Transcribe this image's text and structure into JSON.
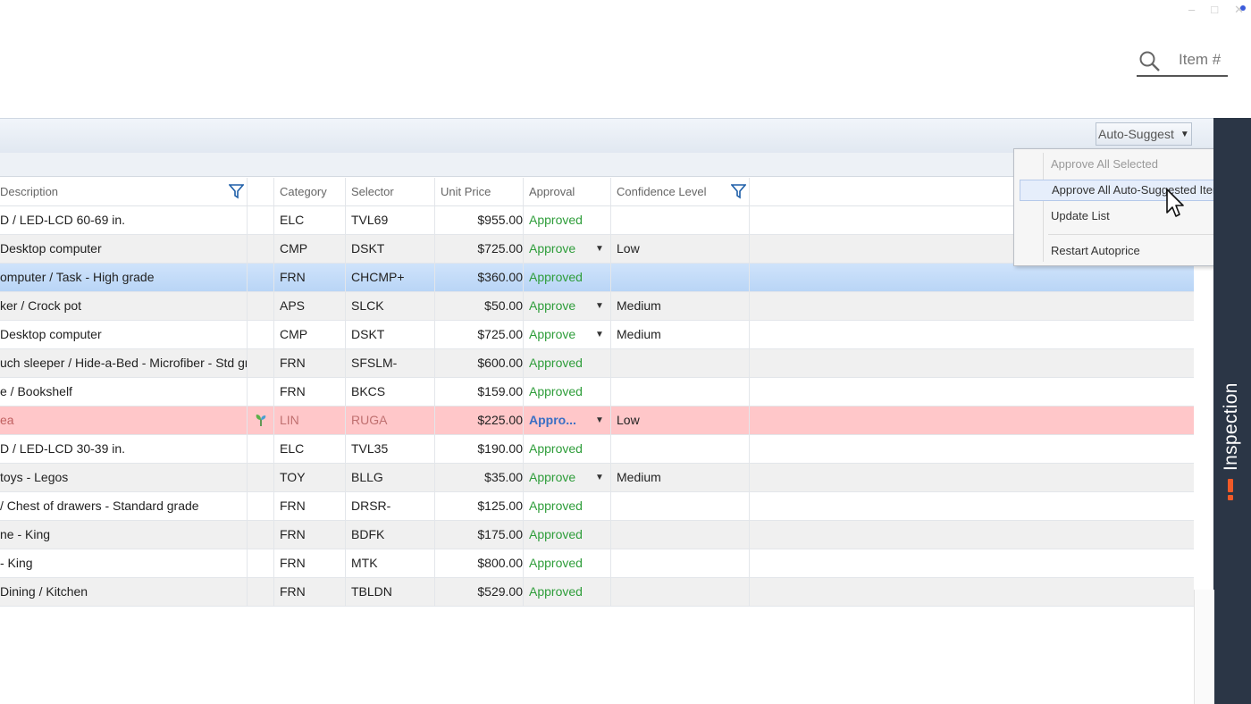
{
  "search": {
    "placeholder": "Item #"
  },
  "toolbar": {
    "auto_suggest_label": "Auto-Suggest"
  },
  "columns": {
    "description": "Description",
    "category": "Category",
    "selector": "Selector",
    "unit_price": "Unit Price",
    "approval": "Approval",
    "confidence": "Confidence Level"
  },
  "rows": [
    {
      "description": "D / LED-LCD 60-69 in.",
      "category": "ELC",
      "selector": "TVL69",
      "price": "$955.00",
      "approval": "Approved",
      "confidence": ""
    },
    {
      "description": "Desktop computer",
      "category": "CMP",
      "selector": "DSKT",
      "price": "$725.00",
      "approval": "Approve",
      "confidence": "Low"
    },
    {
      "description": "omputer / Task - High grade",
      "category": "FRN",
      "selector": "CHCMP+",
      "price": "$360.00",
      "approval": "Approved",
      "confidence": ""
    },
    {
      "description": "ker / Crock pot",
      "category": "APS",
      "selector": "SLCK",
      "price": "$50.00",
      "approval": "Approve",
      "confidence": "Medium"
    },
    {
      "description": "Desktop computer",
      "category": "CMP",
      "selector": "DSKT",
      "price": "$725.00",
      "approval": "Approve",
      "confidence": "Medium"
    },
    {
      "description": "uch sleeper / Hide-a-Bed - Microfiber - Std grad",
      "category": "FRN",
      "selector": "SFSLM-",
      "price": "$600.00",
      "approval": "Approved",
      "confidence": ""
    },
    {
      "description": "e / Bookshelf",
      "category": "FRN",
      "selector": "BKCS",
      "price": "$159.00",
      "approval": "Approved",
      "confidence": ""
    },
    {
      "description": "ea",
      "category": "LIN",
      "selector": "RUGA",
      "price": "$225.00",
      "approval": "Appro...",
      "confidence": "Low"
    },
    {
      "description": "D / LED-LCD 30-39 in.",
      "category": "ELC",
      "selector": "TVL35",
      "price": "$190.00",
      "approval": "Approved",
      "confidence": ""
    },
    {
      "description": "toys - Legos",
      "category": "TOY",
      "selector": "BLLG",
      "price": "$35.00",
      "approval": "Approve",
      "confidence": "Medium"
    },
    {
      "description": "/ Chest of drawers - Standard grade",
      "category": "FRN",
      "selector": "DRSR-",
      "price": "$125.00",
      "approval": "Approved",
      "confidence": ""
    },
    {
      "description": "ne - King",
      "category": "FRN",
      "selector": "BDFK",
      "price": "$175.00",
      "approval": "Approved",
      "confidence": ""
    },
    {
      "description": "- King",
      "category": "FRN",
      "selector": "MTK",
      "price": "$800.00",
      "approval": "Approved",
      "confidence": ""
    },
    {
      "description": "Dining / Kitchen",
      "category": "FRN",
      "selector": "TBLDN",
      "price": "$529.00",
      "approval": "Approved",
      "confidence": ""
    }
  ],
  "menu": {
    "approve_all_selected": "Approve All Selected",
    "approve_all_auto": "Approve All Auto-Suggested Items",
    "update_list": "Update List",
    "restart_autoprice": "Restart Autoprice"
  },
  "side_panel": {
    "label": "Inspection"
  },
  "colors": {
    "approved": "#2e9d3a",
    "selected_row": "#c4dcf8",
    "warning_row": "#ffc7c9",
    "panel": "#2b3646",
    "accent": "#f05a28"
  }
}
